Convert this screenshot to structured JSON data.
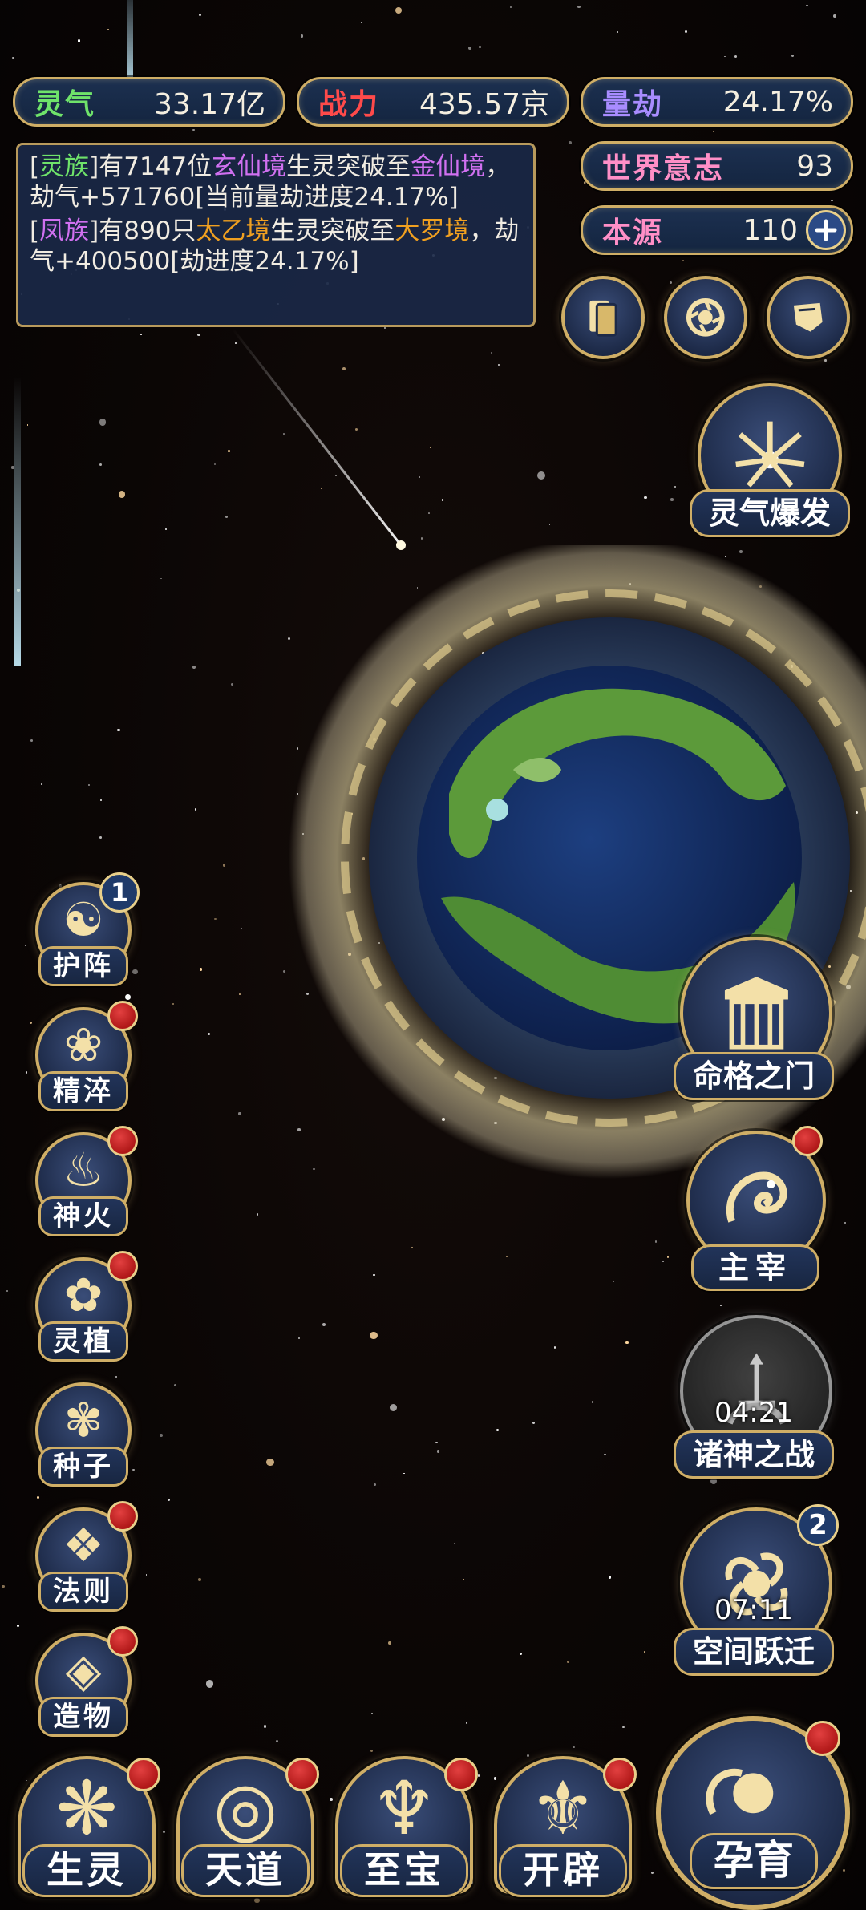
{
  "stats": {
    "lingqi": {
      "label": "灵气",
      "value": "33.17亿"
    },
    "zhanli": {
      "label": "战力",
      "value": "435.57京"
    },
    "liangjie": {
      "label": "量劫",
      "value": "24.17%"
    },
    "shijie": {
      "label": "世界意志",
      "value": "93"
    },
    "benyuan": {
      "label": "本源",
      "value": "110"
    }
  },
  "log": {
    "line1": {
      "bracket_open": "[",
      "tribe": "灵族",
      "bracket_close": "]",
      "t1": "有7147位",
      "realm_from": "玄仙境",
      "t2": "生灵突破至",
      "realm_to": "金仙境",
      "t3": "，劫气+571760[当前量劫进度24.17%]"
    },
    "line2": {
      "bracket_open": "[",
      "tribe": "凤族",
      "bracket_close": "]",
      "t1": "有890只",
      "realm_from": "太乙境",
      "t2": "生灵突破至",
      "realm_to": "大罗境",
      "t3": "，劫气+400500[劫进度24.17%]"
    }
  },
  "right_buttons": {
    "burst": "灵气爆发",
    "fate_gate": "命格之门",
    "master": "主宰",
    "gods_war": "诸神之战",
    "gods_war_timer": "04:21",
    "space_jump": "空间跃迁",
    "space_jump_timer": "07:11",
    "space_jump_badge": "2",
    "nurture": "孕育"
  },
  "left_buttons": [
    {
      "label": "护阵",
      "badge": "1"
    },
    {
      "label": "精淬"
    },
    {
      "label": "神火"
    },
    {
      "label": "灵植"
    },
    {
      "label": "种子"
    },
    {
      "label": "法则"
    },
    {
      "label": "造物"
    }
  ],
  "bottom_buttons": [
    {
      "label": "生灵"
    },
    {
      "label": "天道"
    },
    {
      "label": "至宝"
    },
    {
      "label": "开辟"
    }
  ],
  "colors": {
    "gold_border": "#cfae66",
    "panel_blue": "#1c3050",
    "lingqi_label": "#6fe36a",
    "zhanli_label": "#ff4a4a",
    "liangjie_label": "#a88cff",
    "shijie_label": "#ff8fc7",
    "benyuan_label": "#ff8fc7"
  }
}
